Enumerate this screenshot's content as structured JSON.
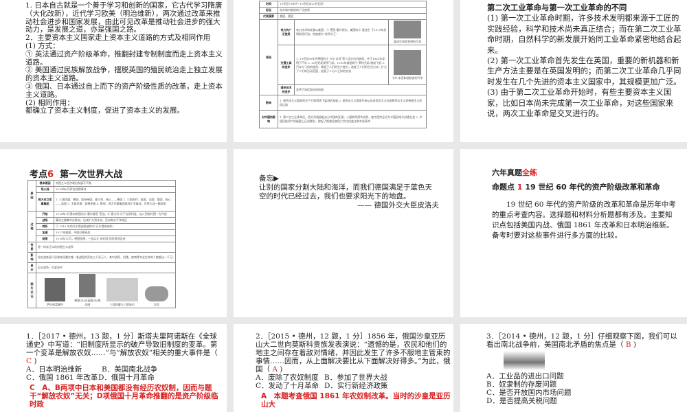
{
  "slide1": {
    "lines": [
      "1. 日本自古就是一个善于学习和创新的国家，它古代学习隋唐（大化改新），近代学习欧美（明治维新），两次通过改革来推动社会进步和国家发展，由此可见改革是推动社会进步的强大动力，是发展之道，亦是强国之路。",
      "2．主要资本主义国家走上资本主义道路的方式及相同作用",
      "(1) 方式：",
      "① 英法通过资产阶级革命，推翻封建专制制度而走上资本主义道路。",
      "② 美国通过民族解放战争，摆脱英国的殖民统治走上独立发展的资本主义道路。",
      "③ 俄国、日本通过自上而下的资产阶级性质的改革，走上资本主义道路。",
      "(2) 相同作用：",
      "都确立了资本主义制度，促进了资本主义的发展。"
    ]
  },
  "slide2": {
    "rows": [
      {
        "h": "时间",
        "v": "19世纪70年代~19世纪末20世纪初"
      },
      {
        "h": "标志",
        "v": "电力和内燃机的广泛使用"
      },
      {
        "h": "代表国家",
        "v": "美国、德国"
      }
    ],
    "perf_label": "表现",
    "sub": [
      {
        "h": "电力的广泛使用",
        "v": "电力技术的发展以美国、① 德国 最为领先。美国的② 爱迪生 于1879年发明耐用灯泡，他被誉为“发明大王”",
        "cap": "爱迪生和他发明的灯泡"
      },
      {
        "h": "交通工具的进步",
        "v": "1. 19世纪80年代德国的③ 卡尔·本茨 等人设计出内燃机，并于1885年发明了汽车 2. 20世纪初发明飞机，1903年美国的④ 莱特兄弟 制成飞机 3. 汽车与飞机的使用，增强了人们的生产能力，改变了人们的生活方式，扩大了人们的活动范围，加强了人与人之间的交流",
        "cap": "卡尔·本茨和他制造的汽车"
      },
      {
        "h": "通讯技术的进步",
        "v": "发明了电话和无线电报"
      }
    ],
    "rows2": [
      {
        "h": "影响",
        "v": "1. 使资本主义国家的生产力获得突飞猛进的发展 2. 使资本主义国家开始从自由资本主义向垄断资本主义即帝国主义阶段过渡"
      },
      {
        "h": "对中国的影响",
        "v": "1. 第二次工业革命后，西方列强掀起瓜分中国的狂潮，八国联军侵华战争，使中国完全沦为半殖民地半封建社会 2. 中国民族资产阶级登上历史舞台，掀起了挽救民族危亡的戊戌变法和辛亥革命"
      }
    ]
  },
  "slide3": {
    "title": "第二次工业革命与第一次工业革命的不同",
    "lines": [
      "(1) 第一次工业革命时期，许多技术发明都来源于工匠的实践经验，科学和技术尚未真正结合；而在第二次工业革命时期，自然科学的新发展开始同工业革命紧密地结合起来。",
      "(2) 第一次工业革命首先发生在英国，重要的新机器和新生产方法主要是在英国发明的；而第二次工业革命几乎同时发生在几个先进的资本主义国家中，其规模更加广泛。",
      "(3) 由于第二次工业革命开始时，有些主要资本主义国家，比如日本尚未完成第一次工业革命，对这些国家来说，两次工业革命是交叉进行的。"
    ]
  },
  "slide4": {
    "title_prefix": "考点",
    "title_num": "6",
    "title": "第一次世界大战",
    "rows": [
      {
        "g": "原因",
        "h": "根本原因",
        "v": "帝国主义经济政治发展不平衡"
      },
      {
        "g": "",
        "h": "导火线",
        "v": "1914年6月萨拉热窝事件"
      },
      {
        "g": "",
        "h": "两大对立军事集团",
        "v": "1. 三国同盟：德国、奥匈帝国、意大利，核心——德国 2. 三国协约：英国、法国、俄国，核心——英国 3. 主要矛盾：英德矛盾 4. 影响：两大军事集团疯狂扩军备战，世界大战一触即发"
      },
      {
        "g": "过程",
        "h": "开始",
        "v": "1914年7月奥匈帝国向⑤ 塞尔维亚 宣战。⑥ 意大利 为了自身利益，加入到协约国一方作战"
      },
      {
        "g": "",
        "h": "战场",
        "v": "最初主要集中在欧洲，后来扩大到非洲、亚洲和太平洋地区"
      },
      {
        "g": "",
        "h": "转折",
        "v": "⑦ 1916 年的凡尔登战役被称为“凡尔登绞肉机”"
      },
      {
        "g": "",
        "h": "加速",
        "v": "1917年美国、中国对德宣战"
      },
      {
        "g": "",
        "h": "结束",
        "v": "1918年11月，德国投降，一战以⑧ 协约国 的失败而告终"
      },
      {
        "g": "性质",
        "h": "",
        "v": "是一场非正义的帝国主义战争"
      },
      {
        "g": "影响",
        "h": "",
        "v": "给交战各国人民带来深重灾难（参战国共死伤三千多万人，其中战死、饥饿、疾病等夺去生命的人数超过一千万）"
      },
      {
        "g": "启示",
        "h": "",
        "v": "反对战争，珍爱和平"
      }
    ],
    "pic_label": "图片识记",
    "captions": [
      "萨拉热窝事件",
      "德国(左)向英国(右)挑战画",
      "三国同盟与三国协约",
      "坦克"
    ]
  },
  "slide5": {
    "label": "备忘▶",
    "quote": "让别的国家分割大陆和海洋，而我们德国满足于蓝色天空的时代已经过去，我们也要求阳光下的地盘。",
    "author": "—— 德国外交大臣皮洛夫"
  },
  "slide6": {
    "head1": "六年真题",
    "head1_red": "全练",
    "head2_prefix": "命题点",
    "head2_num": "1",
    "head2": "19 世纪 60 年代的资产阶级改革和革命",
    "para": "19 世纪 60 年代的资产阶级的改革和革命是历年中考的重点考查内容。选择题和材料分析题都有涉及。主要知识点包括美国内战、俄国 1861 年改革和日本明治维新。备考时要对这些事件进行多方面的比较。"
  },
  "slide7": {
    "question": "1．［2017 • 德州，13 题，1 分］斯塔夫里阿诺斯在《全球通史》中写道：“旧制度所显示的破产导致旧制度的变革。第一个变革是解放农奴……”与“解放农奴”相关的重大事件是（",
    "answer": "C",
    "close": ")",
    "options": [
      "A．日本明治维新",
      "B．美国南北战争",
      "C．俄国 1861 年改革",
      "D．俄国十月革命"
    ],
    "explain": "C　A、B两项中日本和美国都没有经历农奴制，因而与题干“解放农奴”无关；D项俄国十月革命推翻的是资产阶级临时政"
  },
  "slide8": {
    "question": "2．［2015 • 德州，12 题，1 分］1856 年，俄国沙皇亚历山大二世向莫斯科贵族发表演说：“遗憾的是，农民和他们的地主之间存在着敌对情绪，并因此发生了许多不服地主管束的事情……因而，从上面解决要比从下面解决好得多。”为此，俄国（",
    "answer": "A",
    "close": ")",
    "options": [
      "A．废除了农奴制度",
      "B．参加了世界大战",
      "C．发动了十月革命",
      "D．实行新经济政策"
    ],
    "explain": "A　本题考查俄国 1861 年农奴制改革。当时的沙皇是亚历山大"
  },
  "slide9": {
    "question": "3．［2014 • 德州，12 题，1 分］仔细观察下图，我们可以看出南北战争前，美国南北矛盾的焦点是（",
    "answer": "B",
    "close": ")",
    "options": [
      "A．工业品的进出口问题",
      "B．奴隶制的存废问题",
      "C．是否开放国内市场问题",
      "D．是否提高关税问题"
    ]
  }
}
